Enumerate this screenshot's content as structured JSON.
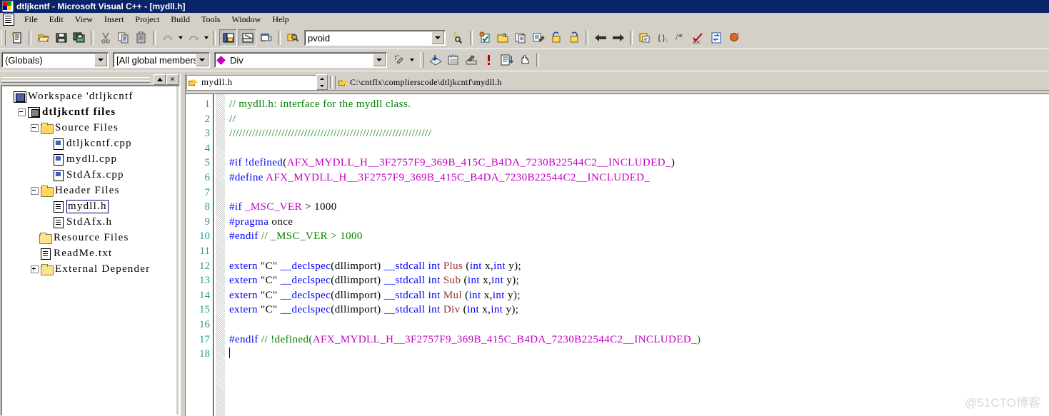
{
  "window": {
    "title": "dtljkcntf - Microsoft Visual C++ - [mydll.h]",
    "app_icon": "vc-app-icon"
  },
  "menubar": {
    "doc_icon": "document-icon",
    "items": [
      "File",
      "Edit",
      "View",
      "Insert",
      "Project",
      "Build",
      "Tools",
      "Window",
      "Help"
    ]
  },
  "toolbar_standard": {
    "buttons": [
      "new-text-file-icon",
      "open-icon",
      "save-icon",
      "save-all-icon",
      "cut-icon",
      "copy-icon",
      "paste-icon",
      "undo-icon",
      "redo-icon",
      "workspace-icon",
      "output-icon",
      "window-list-icon",
      "find-in-files-icon"
    ],
    "find_value": "pvoid",
    "find_placeholder": "",
    "find_combo_icon": "chevron-down-icon",
    "search_help_icon": "find-help-icon"
  },
  "toolbar_build": {
    "buttons": [
      "compile-icon",
      "build-icon",
      "rebuild-all-icon",
      "batch-build-icon",
      "stop-build-icon",
      "execute-icon",
      "go-back-icon",
      "go-forward-icon",
      "insert-file-icon",
      "braces-icon",
      "comment-icon",
      "spelling-icon",
      "refresh-icon",
      "stop-icon"
    ]
  },
  "toolbar_classview": {
    "scope_value": "(Globals)",
    "members_value": "[All global members]",
    "symbol_value": "Div",
    "symbol_icon": "member-function-icon",
    "wizard_icon": "wizard-bar-icon",
    "buttons": [
      "go-to-definition-icon",
      "go-to-declaration-icon",
      "go-to-reference-icon",
      "error-icon",
      "list-icon",
      "hand-icon"
    ]
  },
  "workspace": {
    "minimize_icon": "minimize-icon",
    "close_icon": "close-icon",
    "tree": [
      {
        "label": "Workspace 'dtljkcntf",
        "icon": "workspace-icon",
        "depth": 0,
        "expander": "none",
        "bold": false,
        "selected": false
      },
      {
        "label": "dtljkcntf files",
        "icon": "project-icon",
        "depth": 1,
        "expander": "minus",
        "bold": true,
        "selected": false
      },
      {
        "label": "Source Files",
        "icon": "folder-open-icon",
        "depth": 2,
        "expander": "minus",
        "bold": false,
        "selected": false
      },
      {
        "label": "dtljkcntf.cpp",
        "icon": "cpp-file-icon",
        "depth": 3,
        "expander": "none",
        "bold": false,
        "selected": false
      },
      {
        "label": "mydll.cpp",
        "icon": "cpp-file-icon",
        "depth": 3,
        "expander": "none",
        "bold": false,
        "selected": false
      },
      {
        "label": "StdAfx.cpp",
        "icon": "cpp-file-icon",
        "depth": 3,
        "expander": "none",
        "bold": false,
        "selected": false
      },
      {
        "label": "Header Files",
        "icon": "folder-open-icon",
        "depth": 2,
        "expander": "minus",
        "bold": false,
        "selected": false
      },
      {
        "label": "mydll.h",
        "icon": "header-file-icon",
        "depth": 3,
        "expander": "none",
        "bold": false,
        "selected": true
      },
      {
        "label": "StdAfx.h",
        "icon": "header-file-icon",
        "depth": 3,
        "expander": "none",
        "bold": false,
        "selected": false
      },
      {
        "label": "Resource Files",
        "icon": "folder-icon",
        "depth": 2,
        "expander": "none",
        "bold": false,
        "selected": false
      },
      {
        "label": "ReadMe.txt",
        "icon": "text-file-icon",
        "depth": 2,
        "expander": "none",
        "bold": false,
        "selected": false
      },
      {
        "label": "External Depender",
        "icon": "folder-icon",
        "depth": 2,
        "expander": "plus",
        "bold": false,
        "selected": false
      }
    ]
  },
  "file_bar": {
    "file_icon": "arrow-right-icon",
    "file_value": "mydll.h",
    "dropdown_icon": "chevron-down-icon",
    "spinner_icon": "spinner-icon",
    "path_icon": "arrow-right-icon",
    "path_value": "C:\\cntflx\\complierscode\\dtljkcntf\\mydll.h"
  },
  "editor": {
    "line_numbers": [
      "1",
      "2",
      "3",
      "4",
      "5",
      "6",
      "7",
      "8",
      "9",
      "10",
      "11",
      "12",
      "13",
      "14",
      "15",
      "16",
      "17",
      "18"
    ],
    "lines": [
      {
        "n": "1",
        "tokens": [
          {
            "t": "// mydll.h: interface for the mydll class.",
            "c": "cm"
          }
        ]
      },
      {
        "n": "2",
        "tokens": [
          {
            "t": "//",
            "c": "cm"
          }
        ]
      },
      {
        "n": "3",
        "tokens": [
          {
            "t": "//////////////////////////////////////////////////////////////",
            "c": "cm"
          }
        ]
      },
      {
        "n": "4",
        "tokens": []
      },
      {
        "n": "5",
        "tokens": [
          {
            "t": "#if",
            "c": "pp"
          },
          {
            "t": " !defined",
            "c": "kw"
          },
          {
            "t": "(",
            "c": "tx"
          },
          {
            "t": "AFX_MYDLL_H__3F2757F9_369B_415C_B4DA_7230B22544C2__INCLUDED_",
            "c": "mac"
          },
          {
            "t": ")",
            "c": "tx"
          }
        ]
      },
      {
        "n": "6",
        "tokens": [
          {
            "t": "#define",
            "c": "pp"
          },
          {
            "t": " ",
            "c": "tx"
          },
          {
            "t": "AFX_MYDLL_H__3F2757F9_369B_415C_B4DA_7230B22544C2__INCLUDED_",
            "c": "mac"
          }
        ]
      },
      {
        "n": "7",
        "tokens": []
      },
      {
        "n": "8",
        "tokens": [
          {
            "t": "#if",
            "c": "pp"
          },
          {
            "t": " ",
            "c": "tx"
          },
          {
            "t": "_MSC_VER",
            "c": "mac"
          },
          {
            "t": " > 1000",
            "c": "tx"
          }
        ]
      },
      {
        "n": "9",
        "tokens": [
          {
            "t": "#pragma",
            "c": "pp"
          },
          {
            "t": " once",
            "c": "tx"
          }
        ]
      },
      {
        "n": "10",
        "tokens": [
          {
            "t": "#endif",
            "c": "pp"
          },
          {
            "t": " // _MSC_VER > 1000",
            "c": "cm"
          }
        ]
      },
      {
        "n": "11",
        "tokens": []
      },
      {
        "n": "12",
        "tokens": [
          {
            "t": "extern",
            "c": "kw"
          },
          {
            "t": " \"C\" ",
            "c": "tx"
          },
          {
            "t": "__declspec",
            "c": "kw"
          },
          {
            "t": "(",
            "c": "tx"
          },
          {
            "t": "dllimport",
            "c": "tx"
          },
          {
            "t": ") ",
            "c": "tx"
          },
          {
            "t": "__stdcall",
            "c": "kw"
          },
          {
            "t": " ",
            "c": "tx"
          },
          {
            "t": "int",
            "c": "kw"
          },
          {
            "t": " ",
            "c": "tx"
          },
          {
            "t": "Plus",
            "c": "fn"
          },
          {
            "t": " (",
            "c": "tx"
          },
          {
            "t": "int",
            "c": "kw"
          },
          {
            "t": " x,",
            "c": "tx"
          },
          {
            "t": "int",
            "c": "kw"
          },
          {
            "t": " y);",
            "c": "tx"
          }
        ]
      },
      {
        "n": "13",
        "tokens": [
          {
            "t": "extern",
            "c": "kw"
          },
          {
            "t": " \"C\" ",
            "c": "tx"
          },
          {
            "t": "__declspec",
            "c": "kw"
          },
          {
            "t": "(",
            "c": "tx"
          },
          {
            "t": "dllimport",
            "c": "tx"
          },
          {
            "t": ") ",
            "c": "tx"
          },
          {
            "t": "__stdcall",
            "c": "kw"
          },
          {
            "t": " ",
            "c": "tx"
          },
          {
            "t": "int",
            "c": "kw"
          },
          {
            "t": " ",
            "c": "tx"
          },
          {
            "t": "Sub",
            "c": "fn"
          },
          {
            "t": " (",
            "c": "tx"
          },
          {
            "t": "int",
            "c": "kw"
          },
          {
            "t": " x,",
            "c": "tx"
          },
          {
            "t": "int",
            "c": "kw"
          },
          {
            "t": " y);",
            "c": "tx"
          }
        ]
      },
      {
        "n": "14",
        "tokens": [
          {
            "t": "extern",
            "c": "kw"
          },
          {
            "t": " \"C\" ",
            "c": "tx"
          },
          {
            "t": "__declspec",
            "c": "kw"
          },
          {
            "t": "(",
            "c": "tx"
          },
          {
            "t": "dllimport",
            "c": "tx"
          },
          {
            "t": ") ",
            "c": "tx"
          },
          {
            "t": "__stdcall",
            "c": "kw"
          },
          {
            "t": " ",
            "c": "tx"
          },
          {
            "t": "int",
            "c": "kw"
          },
          {
            "t": " ",
            "c": "tx"
          },
          {
            "t": "Mul",
            "c": "fn"
          },
          {
            "t": " (",
            "c": "tx"
          },
          {
            "t": "int",
            "c": "kw"
          },
          {
            "t": " x,",
            "c": "tx"
          },
          {
            "t": "int",
            "c": "kw"
          },
          {
            "t": " y);",
            "c": "tx"
          }
        ]
      },
      {
        "n": "15",
        "tokens": [
          {
            "t": "extern",
            "c": "kw"
          },
          {
            "t": " \"C\" ",
            "c": "tx"
          },
          {
            "t": "__declspec",
            "c": "kw"
          },
          {
            "t": "(",
            "c": "tx"
          },
          {
            "t": "dllimport",
            "c": "tx"
          },
          {
            "t": ") ",
            "c": "tx"
          },
          {
            "t": "__stdcall",
            "c": "kw"
          },
          {
            "t": " ",
            "c": "tx"
          },
          {
            "t": "int",
            "c": "kw"
          },
          {
            "t": " ",
            "c": "tx"
          },
          {
            "t": "Div",
            "c": "fn"
          },
          {
            "t": " (",
            "c": "tx"
          },
          {
            "t": "int",
            "c": "kw"
          },
          {
            "t": " x,",
            "c": "tx"
          },
          {
            "t": "int",
            "c": "kw"
          },
          {
            "t": " y);",
            "c": "tx"
          }
        ]
      },
      {
        "n": "16",
        "tokens": []
      },
      {
        "n": "17",
        "tokens": [
          {
            "t": "#endif",
            "c": "pp"
          },
          {
            "t": " // !defined(",
            "c": "cm"
          },
          {
            "t": "AFX_MYDLL_H__3F2757F9_369B_415C_B4DA_7230B22544C2__INCLUDED_",
            "c": "mac"
          },
          {
            "t": ")",
            "c": "cm"
          }
        ]
      },
      {
        "n": "18",
        "tokens": [],
        "caret": true
      }
    ]
  },
  "watermark": {
    "text": "@51CTO博客"
  },
  "colors": {
    "titlebar": "#0a246a",
    "chrome": "#d4d0c8",
    "comment": "#008000",
    "keyword": "#0000ff",
    "macro": "#c000c0",
    "function": "#993333",
    "line_number": "#2a9a9a",
    "selection_border": "#00007f"
  }
}
